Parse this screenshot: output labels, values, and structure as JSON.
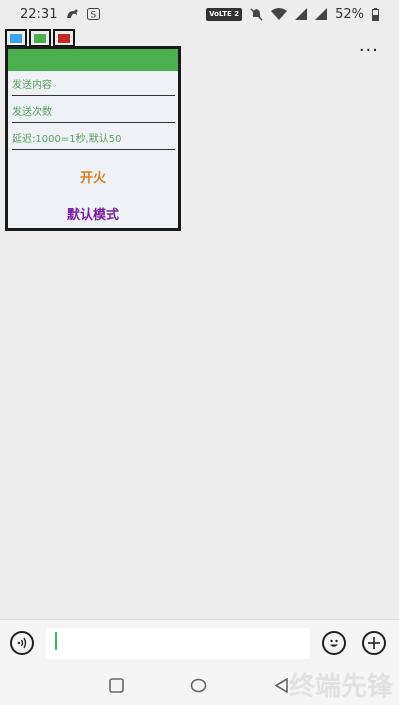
{
  "status_bar": {
    "time": "22:31",
    "network_label": "VoLTE 2",
    "battery": "52%"
  },
  "panel": {
    "tabs": [
      {
        "name": "tab-blue",
        "color": "#3aa4e6"
      },
      {
        "name": "tab-green",
        "color": "#4caf50"
      },
      {
        "name": "tab-red",
        "color": "#c62828"
      }
    ],
    "header_color": "#4caf50",
    "fields": {
      "content_placeholder": "发送内容",
      "count_placeholder": "发送次数",
      "delay_placeholder": "延迟:1000=1秒,默认50"
    },
    "fire_label": "开火",
    "mode_label": "默认模式",
    "fire_color": "#d98020",
    "mode_color": "#7b1fa2"
  },
  "menu": {
    "more_label": "···"
  },
  "input_bar": {
    "value": ""
  },
  "watermark": "终端先锋"
}
